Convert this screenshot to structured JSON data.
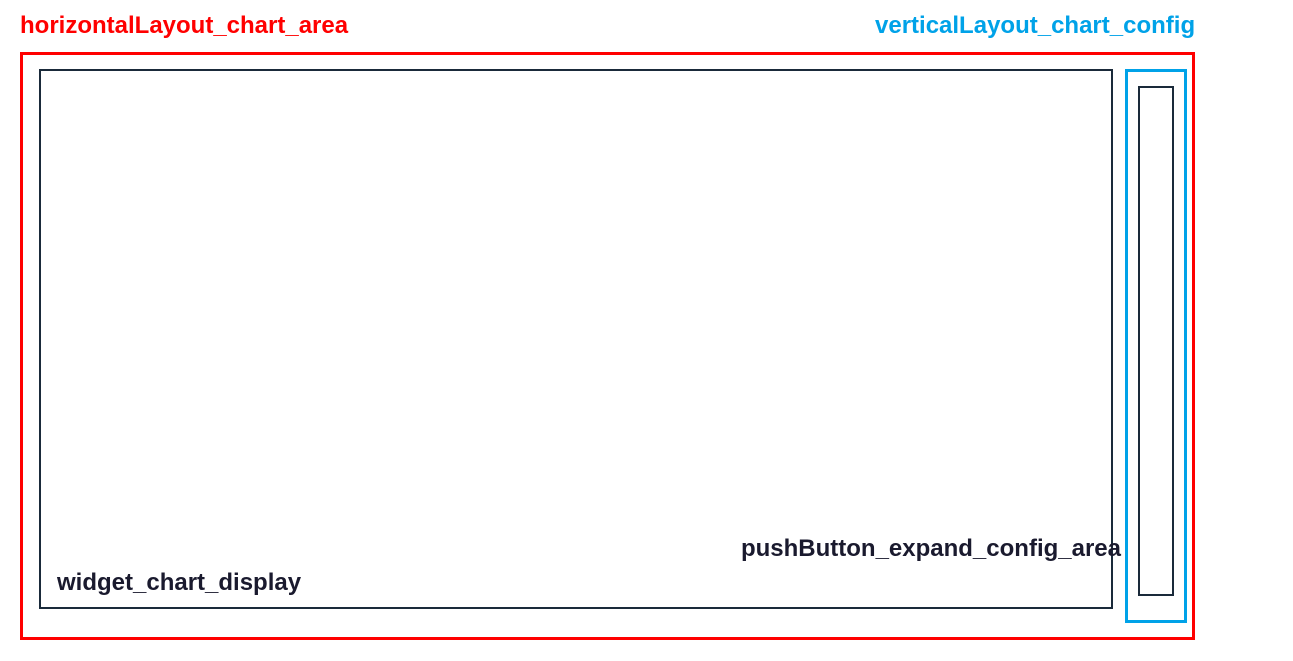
{
  "labels": {
    "horizontal_layout": "horizontalLayout_chart_area",
    "vertical_layout": "verticalLayout_chart_config",
    "widget_chart": "widget_chart_display",
    "push_button": "pushButton_expand_config_area"
  },
  "colors": {
    "red": "#ff0000",
    "cyan": "#00a2e8",
    "dark": "#1a2a3a"
  }
}
